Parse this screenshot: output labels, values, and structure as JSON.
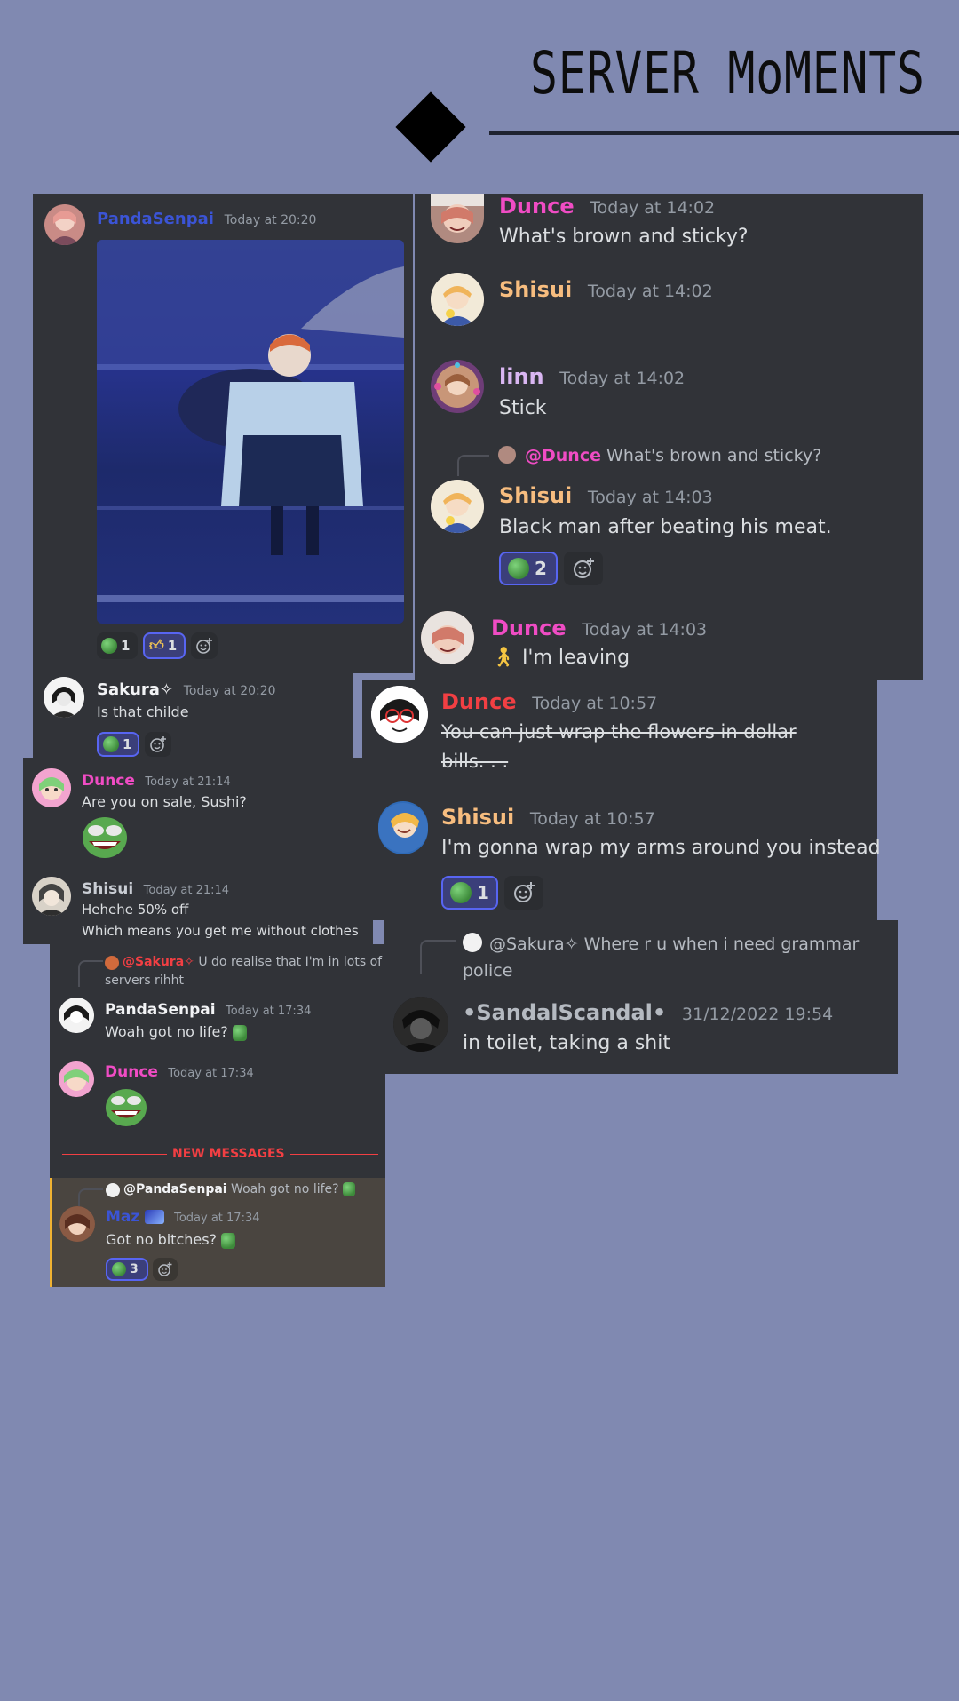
{
  "page": {
    "title": "SERVER MoMENTS",
    "colors": {
      "background": "#8089b1",
      "panel": "#313338",
      "highlight_panel": "#4a4540",
      "dunce_pink": "#f04cc4",
      "shisui_orange": "#f7bd7f",
      "linn_purple": "#d9b6f2",
      "panda_blue": "#3b54d6",
      "new_messages_red": "#f23f43"
    }
  },
  "panel_a": {
    "author": "PandaSenpai",
    "time": "Today at 20:20",
    "reactions": [
      {
        "emoji": "pepe-emoji",
        "count": "1"
      },
      {
        "emoji": "thumbs-up",
        "count": "1"
      }
    ]
  },
  "panel_b": {
    "messages": [
      {
        "author": "Dunce",
        "time": "Today at 14:02",
        "text": "What's brown and sticky?"
      },
      {
        "author": "Shisui",
        "time": "Today at 14:02",
        "text": ""
      },
      {
        "author": "linn",
        "time": "Today at 14:02",
        "text": "Stick"
      },
      {
        "reply_to": "@Dunce",
        "reply_text": "What's brown and sticky?",
        "author": "Shisui",
        "time": "Today at 14:03",
        "text": "Black man after beating his meat.",
        "reaction_count": "2"
      },
      {
        "author": "Dunce",
        "time": "Today at 14:03",
        "text": "I'm leaving"
      }
    ]
  },
  "panel_c": {
    "author": "Sakura✧",
    "time": "Today at 20:20",
    "text": "Is that childe",
    "reaction_count": "1"
  },
  "panel_d": {
    "messages": [
      {
        "author": "Dunce",
        "time": "Today at 10:57",
        "text_line1": "You can just wrap the flowers in dollar",
        "text_line2": "bills. . ."
      },
      {
        "author": "Shisui",
        "time": "Today at 10:57",
        "text": "I'm gonna wrap my arms around you instead",
        "reaction_count": "1"
      }
    ]
  },
  "panel_e": {
    "messages": [
      {
        "author": "Dunce",
        "time": "Today at 21:14",
        "text": "Are you on sale, Sushi?"
      },
      {
        "author": "Shisui",
        "time": "Today at 21:14",
        "text_line1": "Hehehe 50% off",
        "text_line2": "Which means you get me without clothes"
      }
    ]
  },
  "panel_f": {
    "reply_to": "@Sakura✧",
    "reply_text": "Where r u when i need grammar",
    "reply_text2": "police",
    "author": "•SandalScandal•",
    "time": "31/12/2022 19:54",
    "text": "in toilet, taking a shit"
  },
  "panel_g": {
    "reply1_to": "@Sakura✧",
    "reply1_text": "U do realise that I'm in lots of",
    "reply1_text2": "servers rihht",
    "msg1_author": "PandaSenpai",
    "msg1_time": "Today at 17:34",
    "msg1_text": "Woah got no life?",
    "msg2_author": "Dunce",
    "msg2_time": "Today at 17:34",
    "divider": "NEW MESSAGES",
    "reply2_to": "@PandaSenpai",
    "reply2_text": "Woah got no life?",
    "msg3_author": "Maz",
    "msg3_time": "Today at 17:34",
    "msg3_text": "Got no bitches?",
    "reaction_count": "3"
  }
}
